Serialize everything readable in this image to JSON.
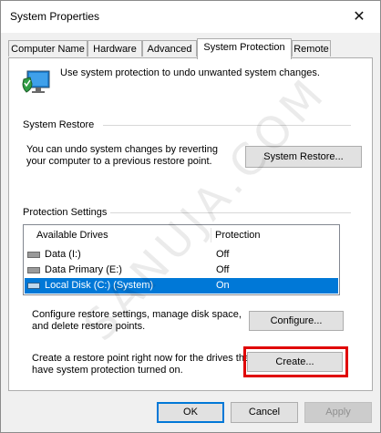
{
  "window": {
    "title": "System Properties"
  },
  "tabs": [
    {
      "label": "Computer Name"
    },
    {
      "label": "Hardware"
    },
    {
      "label": "Advanced"
    },
    {
      "label": "System Protection"
    },
    {
      "label": "Remote"
    }
  ],
  "intro": {
    "text": "Use system protection to undo unwanted system changes."
  },
  "system_restore": {
    "heading": "System Restore",
    "description_line1": "You can undo system changes by reverting",
    "description_line2": "your computer to a previous restore point.",
    "button_label": "System Restore..."
  },
  "protection": {
    "heading": "Protection Settings",
    "columns": [
      "Available Drives",
      "Protection"
    ],
    "drives": [
      {
        "name": "Data (I:)",
        "protection": "Off",
        "selected": false
      },
      {
        "name": "Data Primary (E:)",
        "protection": "Off",
        "selected": false
      },
      {
        "name": "Local Disk (C:) (System)",
        "protection": "On",
        "selected": true
      }
    ],
    "configure_line1": "Configure restore settings, manage disk space,",
    "configure_line2": "and delete restore points.",
    "configure_button": "Configure...",
    "create_line1": "Create a restore point right now for the drives that",
    "create_line2": "have system protection turned on.",
    "create_button": "Create..."
  },
  "footer": {
    "ok": "OK",
    "cancel": "Cancel",
    "apply": "Apply"
  },
  "watermark": "SANUJA.COM",
  "colors": {
    "selection": "#0078d7",
    "highlight_box": "#e00000"
  }
}
